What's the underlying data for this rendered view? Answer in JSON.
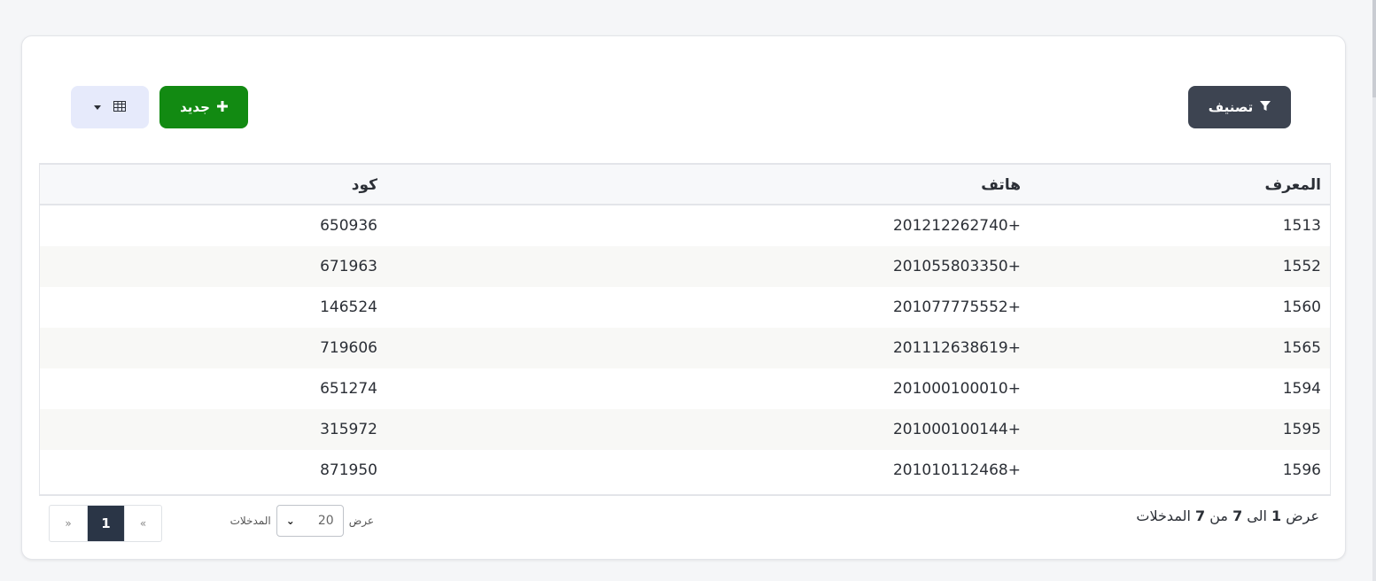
{
  "toolbar": {
    "filter_label": "تصنيف",
    "new_label": "جديد"
  },
  "table": {
    "columns": [
      "المعرف",
      "هاتف",
      "كود"
    ],
    "rows": [
      [
        "1513",
        "201212262740+",
        "650936"
      ],
      [
        "1552",
        "201055803350+",
        "671963"
      ],
      [
        "1560",
        "201077775552+",
        "146524"
      ],
      [
        "1565",
        "201112638619+",
        "719606"
      ],
      [
        "1594",
        "201000100010+",
        "651274"
      ],
      [
        "1595",
        "201000100144+",
        "315972"
      ],
      [
        "1596",
        "201010112468+",
        "871950"
      ]
    ]
  },
  "info": {
    "show": "عرض",
    "start": "1",
    "to": "الى",
    "end": "7",
    "of": "من",
    "total": "7",
    "entries": "المدخلات"
  },
  "length": {
    "show": "عرض",
    "value": "20",
    "entries": "المدخلات"
  },
  "pagination": {
    "prev": "«",
    "current": "1",
    "next": "»"
  },
  "colors": {
    "filter_button": "#3d4451",
    "new_button": "#128a12",
    "view_button": "#e6eafb",
    "active_page": "#2a3546"
  }
}
